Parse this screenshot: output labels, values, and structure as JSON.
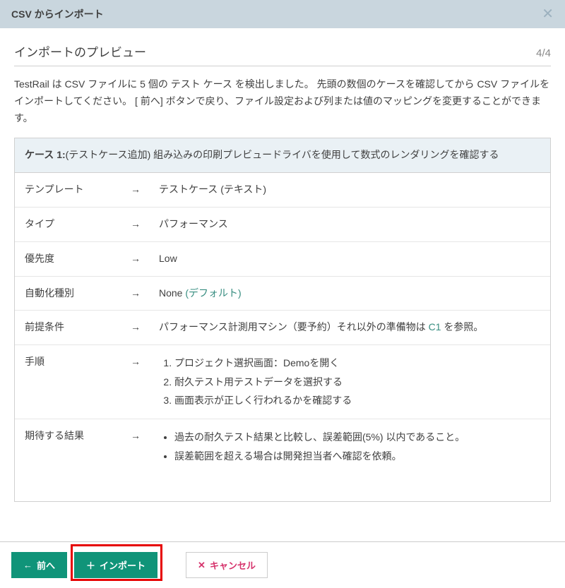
{
  "header": {
    "title": "CSV からインポート"
  },
  "sub": {
    "title": "インポートのプレビュー",
    "step": "4/4"
  },
  "description": "TestRail は CSV ファイルに 5 個の テスト ケース を検出しました。 先頭の数個のケースを確認してから CSV ファイルをインポートしてください。 [ 前へ] ボタンで戻り、ファイル設定および列または値のマッピングを変更することができます。",
  "case": {
    "label": "ケース 1:",
    "action": "(テストケース追加)",
    "title": " 組み込みの印刷プレビュードライバを使用して数式のレンダリングを確認する"
  },
  "arrow": "→",
  "fields": {
    "template": {
      "label": "テンプレート",
      "value": "テストケース (テキスト)"
    },
    "type": {
      "label": "タイプ",
      "value": "パフォーマンス"
    },
    "priority": {
      "label": "優先度",
      "value": "Low"
    },
    "automation": {
      "label": "自動化種別",
      "value": "None ",
      "default": "(デフォルト)"
    },
    "precond": {
      "label": "前提条件",
      "value_pre": "パフォーマンス計測用マシン（要予約）それ以外の準備物は ",
      "link": "C1",
      "value_post": " を参照。"
    },
    "steps": {
      "label": "手順",
      "items": [
        "プロジェクト選択画面：Demoを開く",
        "耐久テスト用テストデータを選択する",
        "画面表示が正しく行われるかを確認する"
      ]
    },
    "expected": {
      "label": "期待する結果",
      "items": [
        "過去の耐久テスト結果と比較し、誤差範囲(5%) 以内であること。",
        "誤差範囲を超える場合は開発担当者へ確認を依頼。"
      ]
    }
  },
  "buttons": {
    "back": "前へ",
    "import": "インポート",
    "cancel": "キャンセル"
  }
}
